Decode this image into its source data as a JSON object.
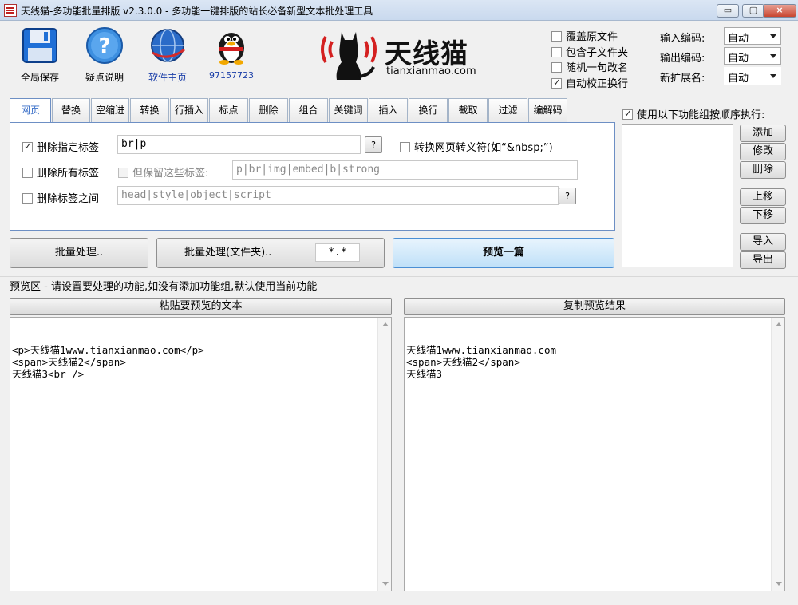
{
  "window": {
    "title": "天线猫-多功能批量排版 v2.3.0.0 - 多功能一键排版的站长必备新型文本批处理工具",
    "btn_min": "▭",
    "btn_max": "▢",
    "btn_close": "×"
  },
  "toolbar": {
    "save_label": "全局保存",
    "help_label": "疑点说明",
    "home_label": "软件主页",
    "qq_label": "97157723"
  },
  "logo": {
    "name": "天线猫",
    "domain": "tianxianmao.com"
  },
  "options": {
    "overwrite": "覆盖原文件",
    "include_sub": "包含子文件夹",
    "random_rename": "随机一句改名",
    "auto_fix_newline": "自动校正换行"
  },
  "encoding": {
    "input_label": "输入编码:",
    "output_label": "输出编码:",
    "ext_label": "新扩展名:",
    "input_value": "自动",
    "output_value": "自动",
    "ext_value": "自动"
  },
  "tabs": [
    "网页",
    "替换",
    "空缩进",
    "转换",
    "行插入",
    "标点",
    "删除",
    "组合",
    "关键词",
    "插入",
    "换行",
    "截取",
    "过滤",
    "编解码"
  ],
  "web": {
    "remove_tags_label": "删除指定标签",
    "remove_tags_value": "br|p",
    "convert_entity_label": "转换网页转义符(如“&nbsp;”)",
    "remove_all_label": "删除所有标签",
    "keep_tags_label": "但保留这些标签:",
    "keep_tags_value": "p|br|img|embed|b|strong",
    "remove_between_label": "删除标签之间",
    "remove_between_value": "head|style|object|script",
    "help_btn": "?"
  },
  "actions": {
    "batch": "批量处理..",
    "batch_folder": "批量处理(文件夹)..",
    "filter_value": "*.*",
    "preview": "预览一篇"
  },
  "group": {
    "use_label": "使用以下功能组按顺序执行:",
    "add": "添加",
    "edit": "修改",
    "delete": "删除",
    "up": "上移",
    "down": "下移",
    "import": "导入",
    "export": "导出"
  },
  "preview": {
    "hint": "预览区 - 请设置要处理的功能,如没有添加功能组,默认使用当前功能",
    "paste_btn": "粘贴要预览的文本",
    "copy_btn": "复制预览结果",
    "input_text": "<p>天线猫1www.tianxianmao.com</p>\n<span>天线猫2</span>\n天线猫3<br />",
    "output_text": "天线猫1www.tianxianmao.com\n<span>天线猫2</span>\n天线猫3"
  }
}
